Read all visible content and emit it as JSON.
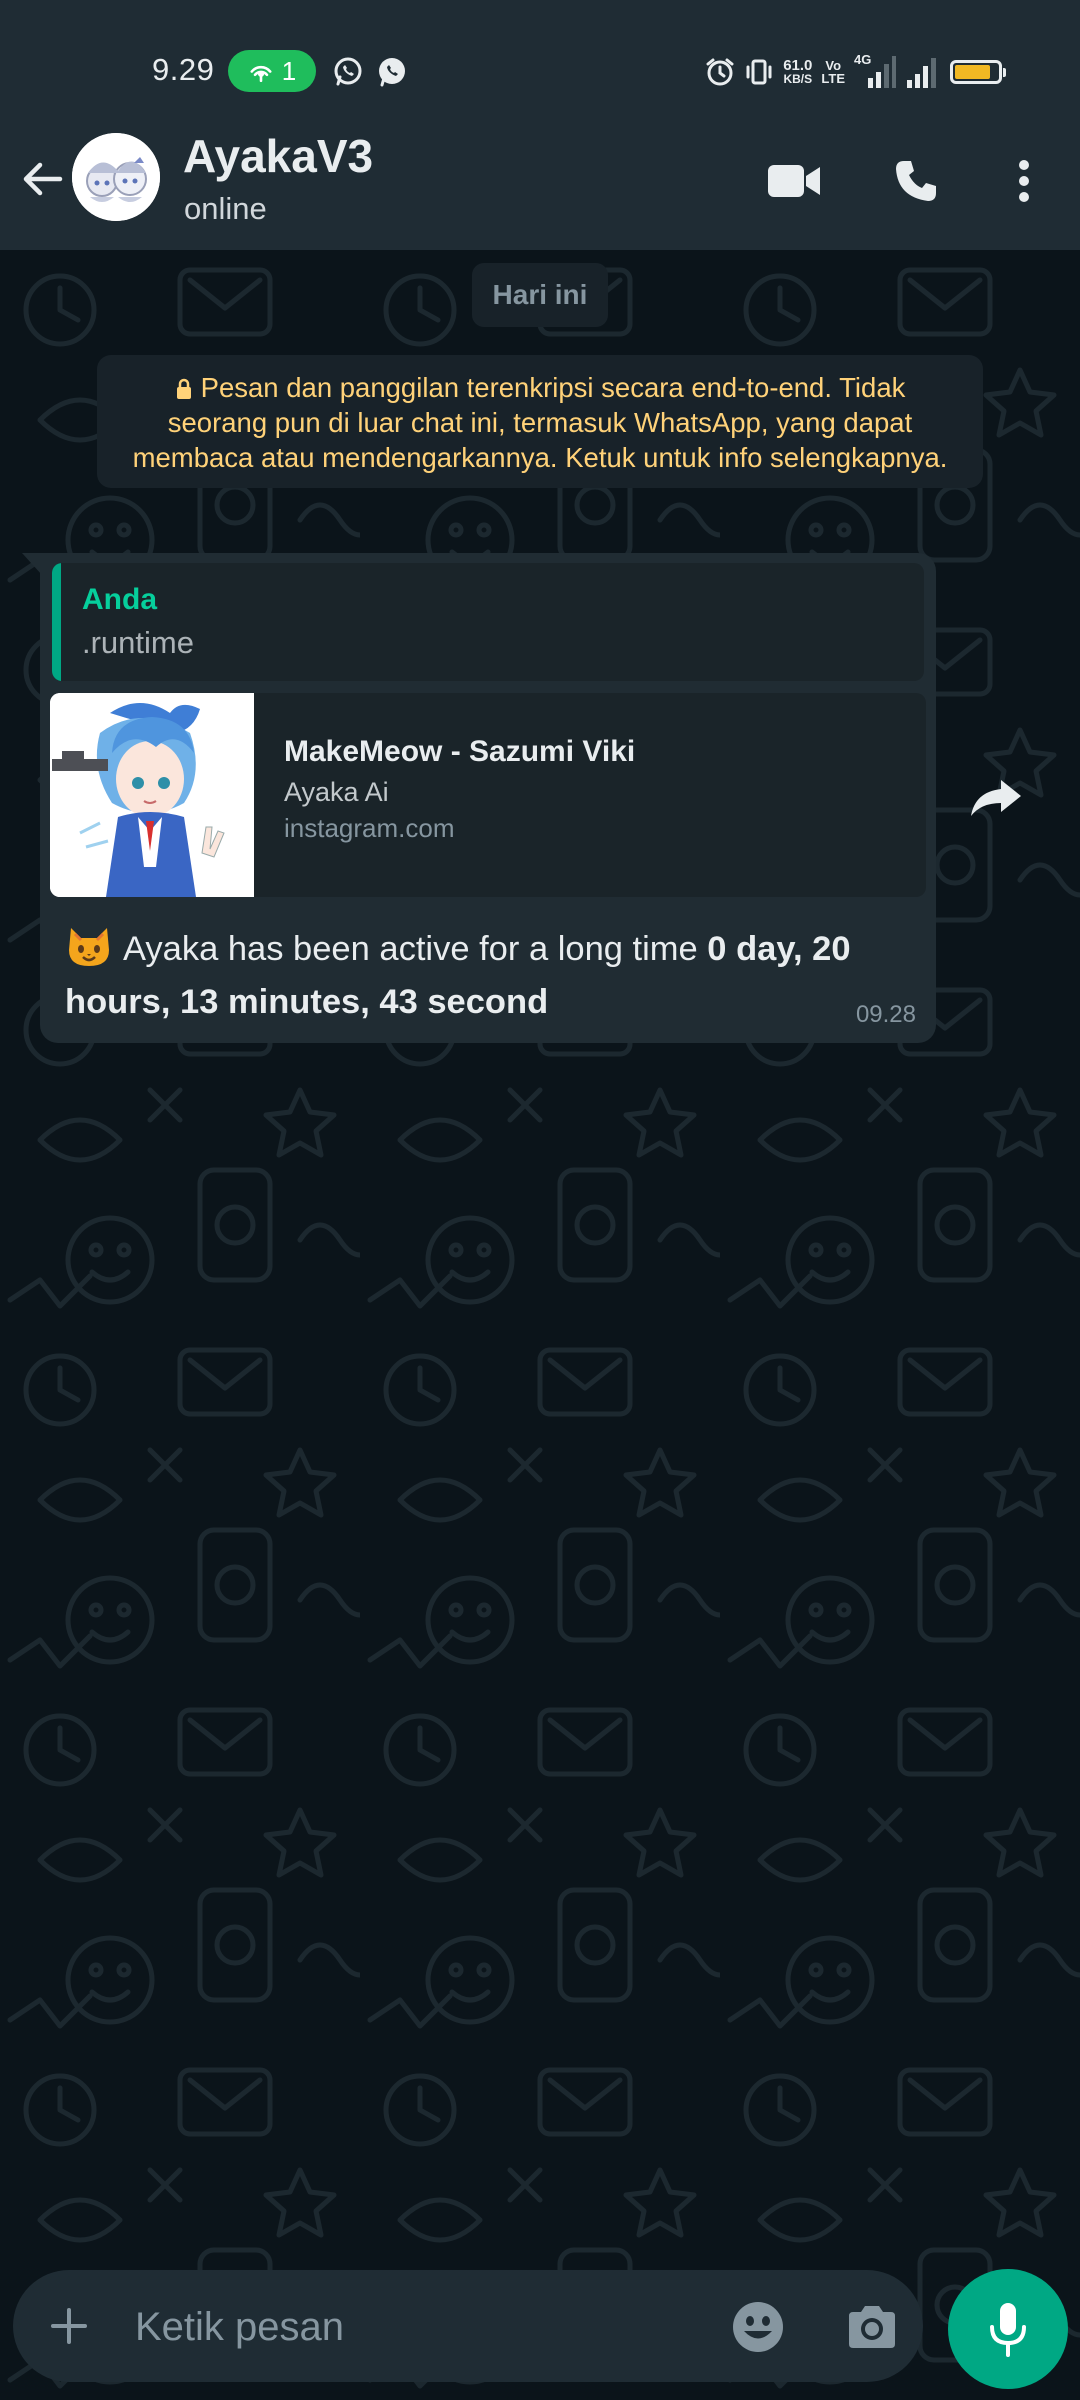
{
  "status_bar": {
    "time": "9.29",
    "hotspot_count": "1",
    "net_speed_value": "61.0",
    "net_speed_unit": "KB/S",
    "volte_top": "Vo",
    "volte_bottom": "LTE",
    "network_type": "4G",
    "battery_level": 0.85,
    "battery_color": "#f1b823"
  },
  "header": {
    "contact_name": "AyakaV3",
    "contact_status": "online",
    "icons": [
      "back-arrow-icon",
      "video-call-icon",
      "voice-call-icon",
      "more-options-icon"
    ]
  },
  "chat": {
    "date_chip": "Hari ini",
    "encryption_notice": "Pesan dan panggilan terenkripsi secara end-to-end. Tidak seorang pun di luar chat ini, termasuk WhatsApp, yang dapat membaca atau mendengarkannya. Ketuk untuk info selengkapnya.",
    "message": {
      "quote_author": "Anda",
      "quote_text": ".runtime",
      "link_title": "MakeMeow - Sazumi Viki",
      "link_description": "Ayaka Ai",
      "link_domain": "instagram.com",
      "emoji": "cat-face-emoji",
      "text_normal": "Ayaka has been active for a long time ",
      "text_bold": "0 day, 20 hours, 13 minutes, 43 second",
      "time": "09.28"
    }
  },
  "composer": {
    "placeholder": "Ketik pesan"
  },
  "colors": {
    "background": "#0b141a",
    "app_bar": "#1f2c34",
    "bubble": "#202c33",
    "accent": "#00a884",
    "quote_author": "#06cf9c",
    "encryption_text": "#ffd279",
    "muted_text": "#8696a0"
  }
}
